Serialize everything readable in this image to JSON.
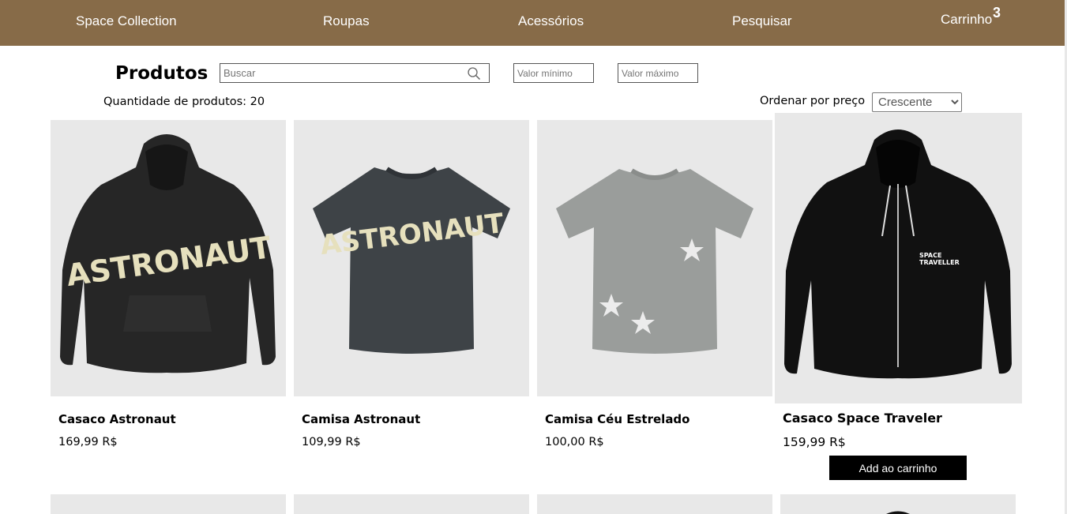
{
  "nav": {
    "brand": "Space Collection",
    "roupas": "Roupas",
    "acessorios": "Acessórios",
    "pesquisar": "Pesquisar",
    "carrinho": "Carrinho",
    "cart_count": "3"
  },
  "toolbar": {
    "title": "Produtos",
    "search_placeholder": "Buscar",
    "min_placeholder": "Valor mínimo",
    "max_placeholder": "Valor máximo",
    "quantity_text": "Quantidade de produtos: 20",
    "order_label": "Ordenar por preço",
    "order_options": [
      "Crescente"
    ],
    "order_selected": "Crescente"
  },
  "products": [
    {
      "name": "Casaco Astronaut",
      "price": "169,99 R$",
      "print": "ASTRONAUT"
    },
    {
      "name": "Camisa Astronaut",
      "price": "109,99 R$",
      "print": "ASTRONAUT"
    },
    {
      "name": "Camisa Céu Estrelado",
      "price": "100,00 R$"
    },
    {
      "name": "Casaco Space Traveler",
      "price": "159,99 R$",
      "print_line1": "SPACE",
      "print_line2": "TRAVELLER",
      "button": "Add ao carrinho"
    }
  ],
  "colors": {
    "navbar": "#876b48",
    "card_background": "#e8e8e8",
    "button": "#000000"
  }
}
